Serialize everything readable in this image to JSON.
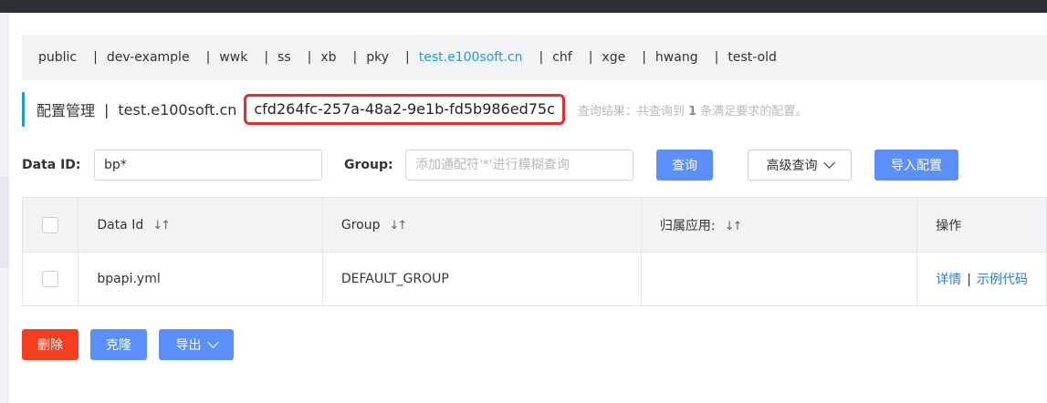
{
  "namespaces": {
    "items": [
      "public",
      "dev-example",
      "wwk",
      "ss",
      "xb",
      "pky",
      "test.e100soft.cn",
      "chf",
      "xge",
      "hwang",
      "test-old"
    ],
    "active_index": 6
  },
  "header": {
    "title": "配置管理",
    "separator": "|",
    "namespace_name": "test.e100soft.cn",
    "namespace_id": "cfd264fc-257a-48a2-9e1b-fd5b986ed75c",
    "result_prefix": "查询结果：共查询到",
    "result_count": "1",
    "result_suffix": "条满足要求的配置。"
  },
  "search": {
    "data_id_label": "Data ID:",
    "data_id_value": "bp*",
    "group_label": "Group:",
    "group_placeholder": "添加通配符'*'进行模糊查询",
    "query_button": "查询",
    "advanced_button": "高级查询",
    "import_button": "导入配置"
  },
  "table": {
    "columns": [
      "Data Id",
      "Group",
      "归属应用:",
      "操作"
    ],
    "sort_icon": "↓↑",
    "rows": [
      {
        "data_id": "bpapi.yml",
        "group": "DEFAULT_GROUP",
        "app": "",
        "op_detail": "详情",
        "op_sep": "|",
        "op_sample": "示例代码"
      }
    ]
  },
  "actions": {
    "delete": "删除",
    "clone": "克隆",
    "export": "导出"
  },
  "colors": {
    "accent": "#1d9bd9",
    "primary": "#5b8ff9",
    "danger": "#f53e20",
    "highlight_border": "#e52b2b"
  }
}
